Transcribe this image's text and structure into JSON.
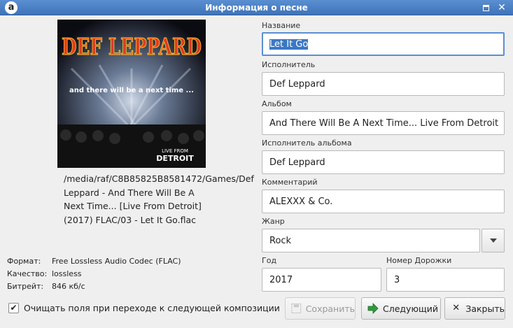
{
  "window": {
    "title": "Информация о песне",
    "app_icon": "a",
    "maximize_icon": "maximize-icon",
    "close_icon": "✕"
  },
  "cover": {
    "band": "DEF LEPPARD",
    "subtitle": "and there will be a next time ...",
    "badge_line1": "LIVE FROM",
    "badge_line2": "DETROIT"
  },
  "file_path": "/media/raf/C8B85825B8581472/Games/Def Leppard - And There Will Be A Next Time... [Live From Detroit] (2017) FLAC/03 - Let It Go.flac",
  "meta": {
    "format_label": "Формат:",
    "format_value": "Free Lossless Audio Codec (FLAC)",
    "quality_label": "Качество:",
    "quality_value": "lossless",
    "bitrate_label": "Битрейт:",
    "bitrate_value": "846 кб/с"
  },
  "fields": {
    "title_label": "Название",
    "title_value": "Let It Go",
    "artist_label": "Исполнитель",
    "artist_value": "Def Leppard",
    "album_label": "Альбом",
    "album_value": "And There Will Be A Next Time... Live From Detroit",
    "album_artist_label": "Исполнитель альбома",
    "album_artist_value": "Def Leppard",
    "comment_label": "Комментарий",
    "comment_value": "ALEXXX & Co.",
    "genre_label": "Жанр",
    "genre_value": "Rock",
    "year_label": "Год",
    "year_value": "2017",
    "track_label": "Номер Дорожки",
    "track_value": "3"
  },
  "footer": {
    "clear_checkbox_checked": true,
    "clear_checkbox_label": "Очищать поля при переходе к следующей композиции",
    "save_label": "Сохранить",
    "next_label": "Следующий",
    "close_label": "Закрыть"
  },
  "colors": {
    "titlebar": "#4a80c6",
    "focus": "#5a8fd1",
    "selection": "#3b78c3",
    "next_arrow": "#2e9a3a"
  }
}
